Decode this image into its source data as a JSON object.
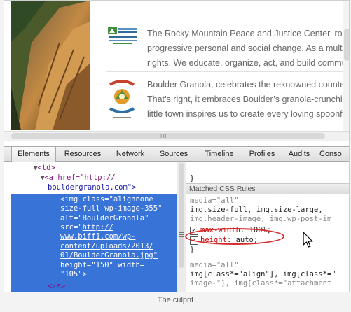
{
  "website": {
    "entries": [
      {
        "logo_name": "rocky-mountain-peace-justice-logo",
        "lines": [
          "The Rocky Mountain Peace and Justice Center, roote",
          "progressive personal and social change. As a multi-",
          "rights. We educate, organize, act, and build commu"
        ]
      },
      {
        "logo_name": "boulder-granola-logo",
        "lines": [
          "Boulder Granola, celebrates the reknowned counte",
          "That’s right, it embraces Boulder’s granola-crunchin",
          "little town inspires us to create every loving spoonfu"
        ]
      }
    ],
    "scroll_grip": "III"
  },
  "devtools": {
    "tabs": [
      "Elements",
      "Resources",
      "Network",
      "Sources",
      "Timeline",
      "Profiles",
      "Audits",
      "Conso"
    ],
    "active_tab": "Elements",
    "elements": {
      "td_line": "<td>",
      "a_open": "<a href=\"http://",
      "a_url": "bouldergranola.com\">",
      "img_lines": [
        "<img class=\"alignnone",
        "size-full wp-image-355\"",
        "alt=\"BoulderGranola\"",
        "src=\"",
        "www.biff1.com/wp-",
        "content/uploads/2013/",
        "01/BoulderGranola.jpg\"",
        "height=\"150\" width=",
        "\"105\">"
      ],
      "img_src_prefix": "http://",
      "a_close": "</a>"
    },
    "styles": {
      "top_brace": "}",
      "section_header": "Matched CSS Rules",
      "rule1_media": "media=\"all\"",
      "rule1_selector_1": "img.size-full, img.size-large,",
      "rule1_selector_2": "img.header-image, img.wp-post-im",
      "rule1_props": [
        {
          "name": "max-width",
          "value": "100%;",
          "checked": true
        },
        {
          "name": "height",
          "value": "auto;",
          "checked": true
        }
      ],
      "rule1_close": "}",
      "rule2_media": "media=\"all\"",
      "rule2_selector_1": "img[class*=\"align\"], img[class*=\"",
      "rule2_selector_2": "image-\"], img[class*=\"attachment"
    }
  },
  "caption": "The culprit",
  "colors": {
    "selection": "#3874d8",
    "annotation": "#d52b2b",
    "css_property": "#c80000",
    "tag": "#881280"
  }
}
